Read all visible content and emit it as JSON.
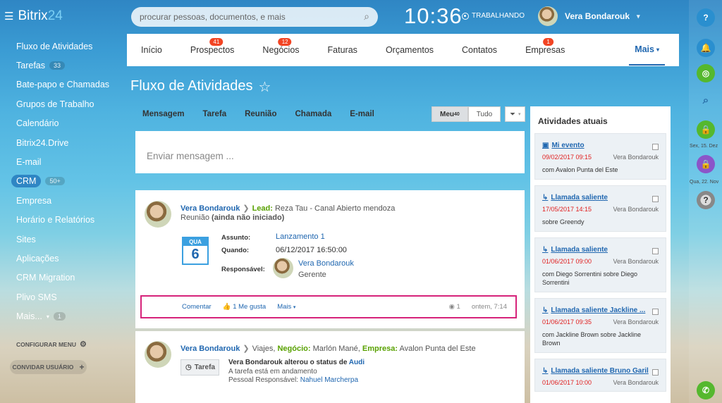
{
  "brand": {
    "name": "Bitrix",
    "num": "24"
  },
  "search": {
    "placeholder": "procurar pessoas, documentos, e mais"
  },
  "clock": {
    "time": "10:36",
    "status": "TRABALHANDO"
  },
  "user": {
    "name": "Vera Bondarouk"
  },
  "left_menu": [
    {
      "label": "Fluxo de Atividades"
    },
    {
      "label": "Tarefas",
      "count": "33"
    },
    {
      "label": "Bate-papo e Chamadas"
    },
    {
      "label": "Grupos de Trabalho"
    },
    {
      "label": "Calendário"
    },
    {
      "label": "Bitrix24.Drive"
    },
    {
      "label": "E-mail"
    },
    {
      "label": "CRM",
      "count": "50+",
      "active": true
    },
    {
      "label": "Empresa"
    },
    {
      "label": "Horário e Relatórios"
    },
    {
      "label": "Sites"
    },
    {
      "label": "Aplicações"
    },
    {
      "label": "CRM Migration"
    },
    {
      "label": "Plivo SMS"
    },
    {
      "label": "Mais...",
      "count": "1"
    }
  ],
  "config_menu": "CONFIGURAR MENU",
  "invite": "CONVIDAR USUÁRIO",
  "top_nav": [
    {
      "label": "Início"
    },
    {
      "label": "Prospectos",
      "badge": "41"
    },
    {
      "label": "Negócios",
      "badge": "12"
    },
    {
      "label": "Faturas"
    },
    {
      "label": "Orçamentos"
    },
    {
      "label": "Contatos"
    },
    {
      "label": "Empresas",
      "badge": "1"
    }
  ],
  "top_nav_more": "Mais",
  "page_title": "Fluxo de Atividades",
  "composer": {
    "tabs": [
      "Mensagem",
      "Tarefa",
      "Reunião",
      "Chamada",
      "E-mail"
    ],
    "placeholder": "Enviar mensagem ..."
  },
  "filter": {
    "mine": "Meu",
    "mine_count": "40",
    "all": "Tudo"
  },
  "post1": {
    "author": "Vera Bondarouk",
    "lead_label": "Lead:",
    "lead_value": "Reza Tau - Canal Abierto mendoza",
    "type": "Reunião",
    "state": "(ainda não iniciado)",
    "cal_dow": "QUA",
    "cal_day": "6",
    "subject_label": "Assunto:",
    "subject": "Lanzamento 1",
    "when_label": "Quando:",
    "when": "06/12/2017 16:50:00",
    "resp_label": "Responsável:",
    "resp_name": "Vera Bondarouk",
    "resp_role": "Gerente",
    "actions": {
      "comment": "Comentar",
      "like": "1 Me gusta",
      "more": "Mais",
      "views": "1",
      "time": "ontem, 7:14"
    }
  },
  "post2": {
    "author": "Vera Bondarouk",
    "prefix": "Viajes,",
    "deal_label": "Negócio:",
    "deal_value": "Marlón Mané,",
    "company_label": "Empresa:",
    "company_value": "Avalon Punta del Este",
    "chip": "Tarefa",
    "line1_pre": "Vera Bondarouk alterou o status de",
    "line1_link": "Audi",
    "line2": "A tarefa está em andamento",
    "line3_label": "Pessoal Responsável:",
    "line3_link": "Nahuel Marcherpa"
  },
  "right_panel": {
    "title": "Atividades atuais",
    "items": [
      {
        "icon": "calendar-icon",
        "title": "Mi evento",
        "date": "09/02/2017 09:15",
        "user": "Vera Bondarouk",
        "desc": "com Avalon Punta del Este"
      },
      {
        "icon": "call-icon",
        "title": "Llamada saliente",
        "date": "17/05/2017 14:15",
        "user": "Vera Bondarouk",
        "desc": "sobre Greendy"
      },
      {
        "icon": "call-icon",
        "title": "Llamada saliente",
        "date": "01/06/2017 09:00",
        "user": "Vera Bondarouk",
        "desc": "com Diego Sorrentini sobre Diego Sorrentini"
      },
      {
        "icon": "call-icon",
        "title": "Llamada saliente Jackline ...",
        "date": "01/06/2017 09:35",
        "user": "Vera Bondarouk",
        "desc": "com Jackline Brown sobre Jackline Brown"
      },
      {
        "icon": "call-icon",
        "title": "Llamada saliente Bruno Garil",
        "date": "01/06/2017 10:00",
        "user": "Vera Bondarouk",
        "desc": ""
      }
    ]
  },
  "right_side": {
    "date1": "Sex, 15. Dez",
    "date2": "Qua, 22. Nov"
  },
  "colors": {
    "accent": "#2067b0",
    "badge": "#f24423",
    "green": "#58a100",
    "highlight": "#d6237a"
  }
}
